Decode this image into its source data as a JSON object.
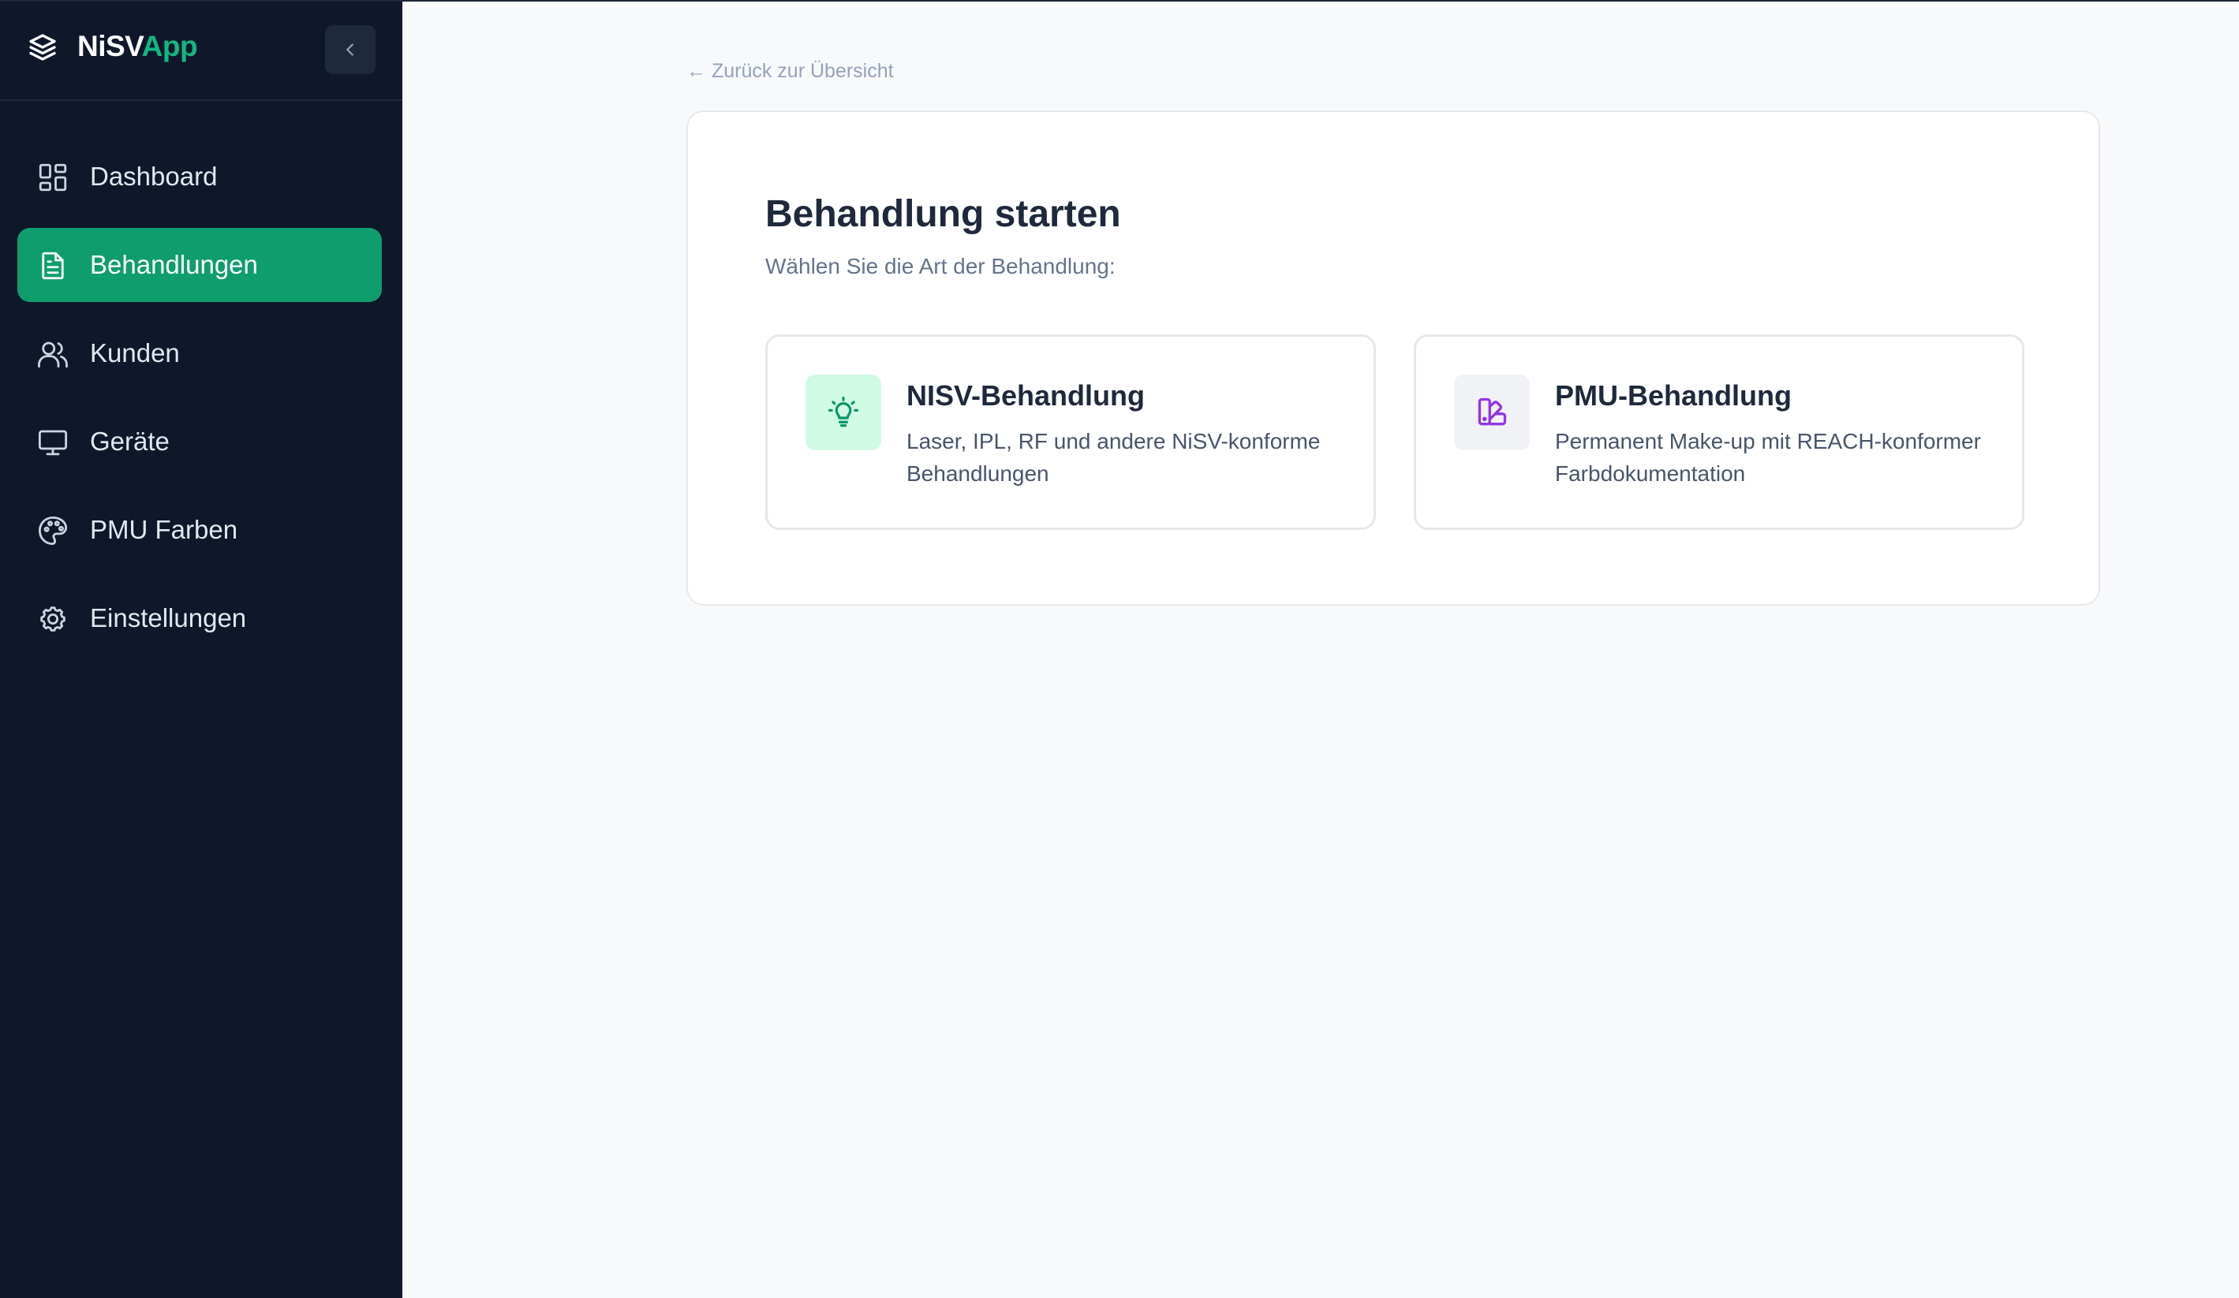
{
  "app": {
    "brand_main": "NiSV",
    "brand_accent": "App",
    "brand_color": "#10b981"
  },
  "sidebar": {
    "items": [
      {
        "label": "Dashboard",
        "icon": "dashboard-icon",
        "active": false
      },
      {
        "label": "Behandlungen",
        "icon": "document-icon",
        "active": true
      },
      {
        "label": "Kunden",
        "icon": "users-icon",
        "active": false
      },
      {
        "label": "Geräte",
        "icon": "monitor-icon",
        "active": false
      },
      {
        "label": "PMU Farben",
        "icon": "palette-icon",
        "active": false
      },
      {
        "label": "Einstellungen",
        "icon": "gear-icon",
        "active": false
      }
    ],
    "active_color": "#0f9d6e",
    "background": "#0f172a"
  },
  "main": {
    "back_link": "← Zurück zur Übersicht",
    "title": "Behandlung starten",
    "subtitle": "Wählen Sie die Art der Behandlung:",
    "options": [
      {
        "title": "NISV-Behandlung",
        "description": "Laser, IPL, RF und andere NiSV-konforme Behandlungen",
        "icon": "lightbulb-icon",
        "icon_bg": "#d1fae5",
        "icon_color": "#059669"
      },
      {
        "title": "PMU-Behandlung",
        "description": "Permanent Make-up mit REACH-konformer Farbdokumentation",
        "icon": "swatch-icon",
        "icon_bg": "#f1f2f5",
        "icon_color": "#9333ea"
      }
    ]
  }
}
